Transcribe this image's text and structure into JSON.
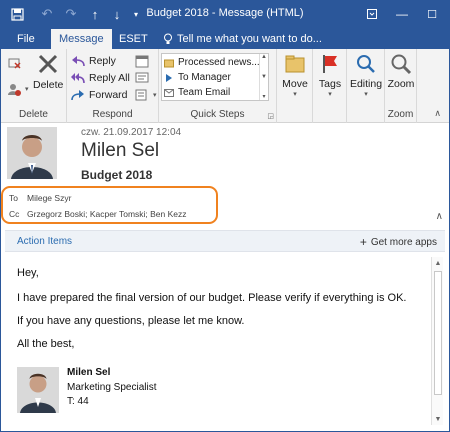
{
  "window": {
    "title": "Budget 2018 - Message (HTML)"
  },
  "tabs": [
    {
      "label": "File"
    },
    {
      "label": "Message"
    },
    {
      "label": "ESET"
    }
  ],
  "tell_me": "Tell me what you want to do...",
  "ribbon": {
    "delete_group": {
      "delete_label": "Delete",
      "group_label": "Delete"
    },
    "respond_group": {
      "reply": "Reply",
      "reply_all": "Reply All",
      "forward": "Forward",
      "group_label": "Respond"
    },
    "quick_steps": {
      "items": [
        "Processed news...",
        "To Manager",
        "Team Email"
      ],
      "group_label": "Quick Steps"
    },
    "move": "Move",
    "tags": "Tags",
    "editing": "Editing",
    "zoom": {
      "button": "Zoom",
      "group_label": "Zoom"
    }
  },
  "header": {
    "date": "czw. 21.09.2017 12:04",
    "sender": "Milen Sel",
    "subject": "Budget 2018",
    "to_label": "To",
    "to_value": "Milege Szyr",
    "cc_label": "Cc",
    "cc_value": "Grzegorz Boski; Kacper Tomski; Ben Kezz"
  },
  "action_bar": {
    "action_items": "Action Items",
    "get_more_apps": "Get more apps"
  },
  "body": {
    "greeting": "Hey,",
    "line1": "I have prepared the final version of our budget. Please verify if everything is OK.",
    "line2": "If you have any questions, please let me know.",
    "closing": "All the best,",
    "signature": {
      "name": "Milen Sel",
      "title": "Marketing Specialist",
      "phone": "T: 44"
    }
  },
  "colors": {
    "accent": "#2b579a",
    "highlight": "#f0821f",
    "link": "#2b6cb0"
  }
}
